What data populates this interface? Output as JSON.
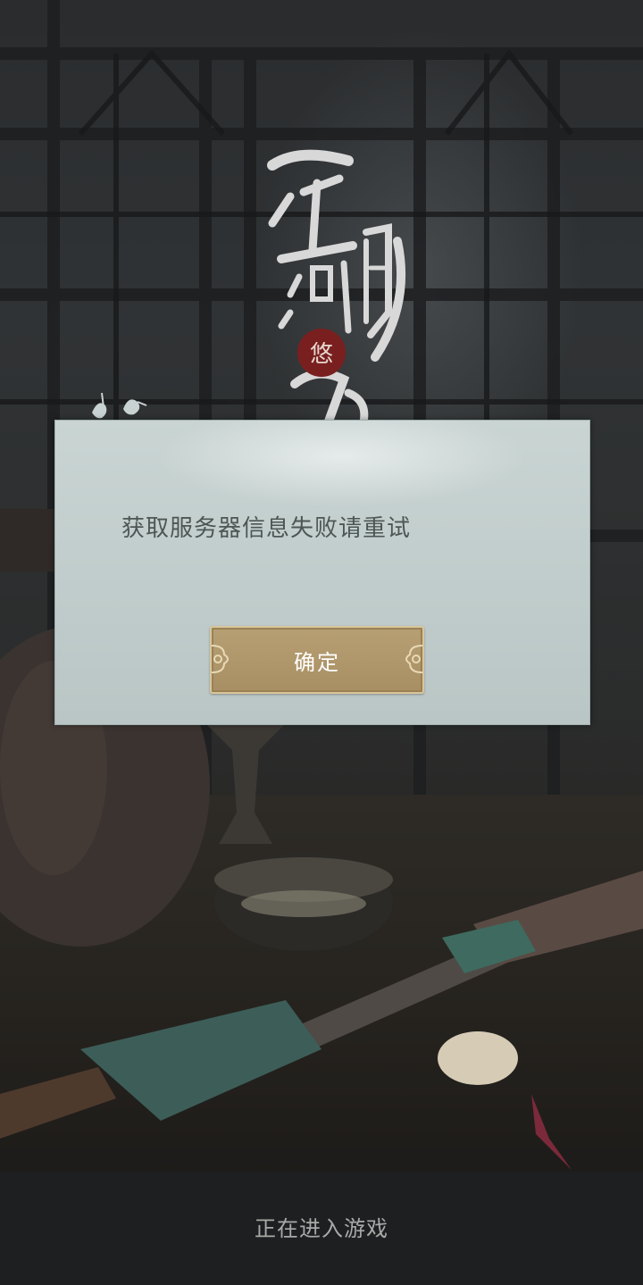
{
  "dialog": {
    "message": "获取服务器信息失败请重试",
    "confirm_label": "确定"
  },
  "logo": {
    "text": "江湖悠悠",
    "seal_text": "悠"
  },
  "footer": {
    "status": "正在进入游戏"
  },
  "colors": {
    "dialog_bg": "#bfcac9",
    "button_gold": "#b09869",
    "button_border": "#d9c59a",
    "message_text": "#4e5655",
    "seal_red": "#7a1f1f"
  }
}
